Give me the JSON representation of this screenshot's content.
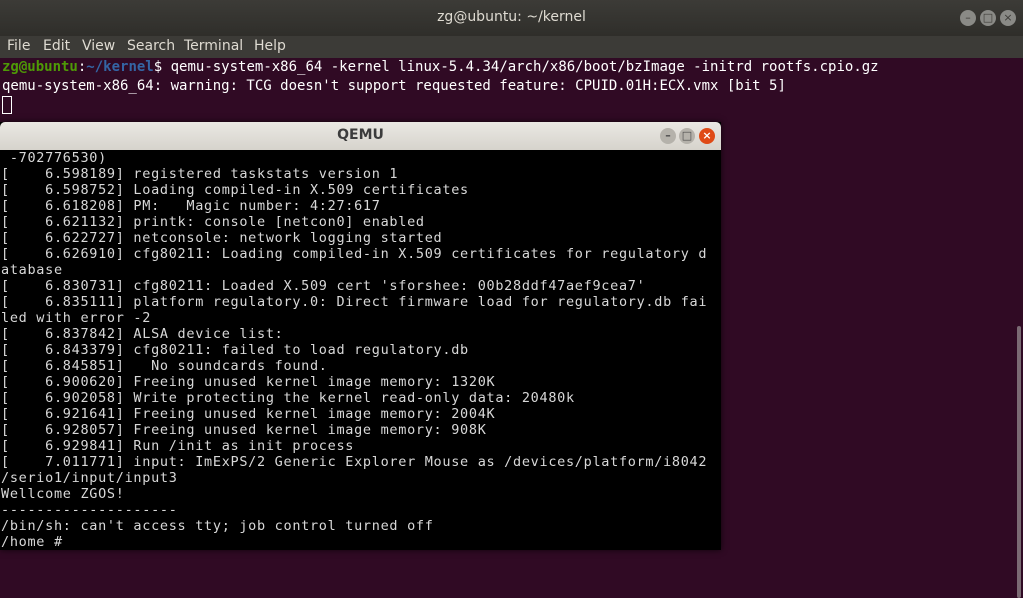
{
  "terminal": {
    "title": "zg@ubuntu: ~/kernel",
    "menu": [
      "File",
      "Edit",
      "View",
      "Search",
      "Terminal",
      "Help"
    ],
    "prompt_user": "zg@ubuntu",
    "prompt_sep": ":",
    "prompt_path": "~/kernel",
    "prompt_symbol": "$",
    "command": " qemu-system-x86_64 -kernel linux-5.4.34/arch/x86/boot/bzImage -initrd rootfs.cpio.gz",
    "warning": "qemu-system-x86_64: warning: TCG doesn't support requested feature: CPUID.01H:ECX.vmx [bit 5]"
  },
  "qemu": {
    "title": "QEMU",
    "lines": [
      " -702776530)",
      "[    6.598189] registered taskstats version 1",
      "[    6.598752] Loading compiled-in X.509 certificates",
      "[    6.618208] PM:   Magic number: 4:27:617",
      "[    6.621132] printk: console [netcon0] enabled",
      "[    6.622727] netconsole: network logging started",
      "[    6.626910] cfg80211: Loading compiled-in X.509 certificates for regulatory d",
      "atabase",
      "[    6.830731] cfg80211: Loaded X.509 cert 'sforshee: 00b28ddf47aef9cea7'",
      "[    6.835111] platform regulatory.0: Direct firmware load for regulatory.db fai",
      "led with error -2",
      "[    6.837842] ALSA device list:",
      "[    6.843379] cfg80211: failed to load regulatory.db",
      "[    6.845851]   No soundcards found.",
      "[    6.900620] Freeing unused kernel image memory: 1320K",
      "[    6.902058] Write protecting the kernel read-only data: 20480k",
      "[    6.921641] Freeing unused kernel image memory: 2004K",
      "[    6.928057] Freeing unused kernel image memory: 908K",
      "[    6.929841] Run /init as init process",
      "[    7.011771] input: ImExPS/2 Generic Explorer Mouse as /devices/platform/i8042",
      "/serio1/input/input3",
      "Wellcome ZGOS!",
      "--------------------",
      "/bin/sh: can't access tty; job control turned off",
      "/home #"
    ]
  }
}
